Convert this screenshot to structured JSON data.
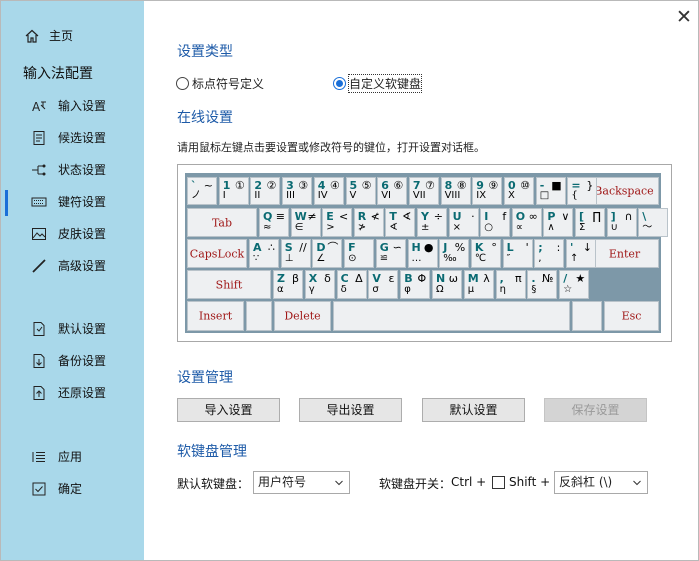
{
  "sidebar": {
    "home": "主页",
    "title": "输入法配置",
    "items": [
      {
        "label": "输入设置",
        "icon": "input-settings-icon"
      },
      {
        "label": "候选设置",
        "icon": "candidate-icon"
      },
      {
        "label": "状态设置",
        "icon": "status-icon"
      },
      {
        "label": "键符设置",
        "icon": "keyboard-icon"
      },
      {
        "label": "皮肤设置",
        "icon": "image-icon"
      },
      {
        "label": "高级设置",
        "icon": "wand-icon"
      },
      {
        "label": "默认设置",
        "icon": "default-doc-icon"
      },
      {
        "label": "备份设置",
        "icon": "backup-icon"
      },
      {
        "label": "还原设置",
        "icon": "restore-icon"
      },
      {
        "label": "应用",
        "icon": "list-icon"
      },
      {
        "label": "确定",
        "icon": "checkbox-icon"
      }
    ],
    "active_index": 3,
    "accent": "#1a6fd8",
    "bg": "#a9d8ea"
  },
  "window": {
    "close_glyph": "✕"
  },
  "type_section": {
    "title": "设置类型",
    "options": [
      "标点符号定义",
      "自定义软键盘"
    ],
    "selected": 1
  },
  "online_section": {
    "title": "在线设置",
    "hint": "请用鼠标左键点击要设置或修改符号的键位，打开设置对话框。"
  },
  "keyboard": {
    "row1": [
      {
        "t": "`",
        "tr": "~",
        "b": "ノ",
        "br": ""
      },
      {
        "t": "1",
        "tr": "①",
        "b": "I",
        "br": ""
      },
      {
        "t": "2",
        "tr": "②",
        "b": "II",
        "br": ""
      },
      {
        "t": "3",
        "tr": "③",
        "b": "III",
        "br": ""
      },
      {
        "t": "4",
        "tr": "④",
        "b": "IV",
        "br": ""
      },
      {
        "t": "5",
        "tr": "⑤",
        "b": "V",
        "br": ""
      },
      {
        "t": "6",
        "tr": "⑥",
        "b": "VI",
        "br": ""
      },
      {
        "t": "7",
        "tr": "⑦",
        "b": "VII",
        "br": ""
      },
      {
        "t": "8",
        "tr": "⑧",
        "b": "VIII",
        "br": ""
      },
      {
        "t": "9",
        "tr": "⑨",
        "b": "IX",
        "br": ""
      },
      {
        "t": "0",
        "tr": "⑩",
        "b": "X",
        "br": ""
      },
      {
        "t": "-",
        "tr": "■",
        "b": "□",
        "br": ""
      },
      {
        "t": "=",
        "tr": "}",
        "b": "{",
        "br": ""
      }
    ],
    "row2": [
      {
        "t": "Q",
        "tr": "≡",
        "b": "≈",
        "br": ""
      },
      {
        "t": "W",
        "tr": "≠",
        "b": "∈",
        "br": ""
      },
      {
        "t": "E",
        "tr": "<",
        "b": ">",
        "br": ""
      },
      {
        "t": "R",
        "tr": "≮",
        "b": "≯",
        "br": ""
      },
      {
        "t": "T",
        "tr": "∢",
        "b": "∢",
        "br": ""
      },
      {
        "t": "Y",
        "tr": "÷",
        "b": "±",
        "br": ""
      },
      {
        "t": "U",
        "tr": "·",
        "b": "×",
        "br": ""
      },
      {
        "t": "I",
        "tr": "f",
        "b": "○",
        "br": ""
      },
      {
        "t": "O",
        "tr": "∞",
        "b": "∝",
        "br": ""
      },
      {
        "t": "P",
        "tr": "∨",
        "b": "∧",
        "br": ""
      },
      {
        "t": "[",
        "tr": "∏",
        "b": "Σ",
        "br": ""
      },
      {
        "t": "]",
        "tr": "∩",
        "b": "∪",
        "br": ""
      },
      {
        "t": "\\",
        "tr": "",
        "b": "〜",
        "br": ""
      }
    ],
    "row3": [
      {
        "t": "A",
        "tr": "∴",
        "b": "∵",
        "br": ""
      },
      {
        "t": "S",
        "tr": "//",
        "b": "⊥",
        "br": ""
      },
      {
        "t": "D",
        "tr": "⌒",
        "b": "∠",
        "br": ""
      },
      {
        "t": "F",
        "tr": "",
        "b": "⊙",
        "br": ""
      },
      {
        "t": "G",
        "tr": "∽",
        "b": "≌",
        "br": ""
      },
      {
        "t": "H",
        "tr": "●",
        "b": "…",
        "br": ""
      },
      {
        "t": "J",
        "tr": "%",
        "b": "‰",
        "br": ""
      },
      {
        "t": "K",
        "tr": "°",
        "b": "℃",
        "br": ""
      },
      {
        "t": "L",
        "tr": "'",
        "b": "″",
        "br": ""
      },
      {
        "t": ";",
        "tr": ":",
        "b": "‚",
        "br": ""
      },
      {
        "t": "'",
        "tr": "↓",
        "b": "↑",
        "br": ""
      }
    ],
    "row4": [
      {
        "t": "Z",
        "tr": "β",
        "b": "α",
        "br": ""
      },
      {
        "t": "X",
        "tr": "δ",
        "b": "γ",
        "br": ""
      },
      {
        "t": "C",
        "tr": "Δ",
        "b": "δ",
        "br": ""
      },
      {
        "t": "V",
        "tr": "ε",
        "b": "σ",
        "br": ""
      },
      {
        "t": "B",
        "tr": "Φ",
        "b": "φ",
        "br": ""
      },
      {
        "t": "N",
        "tr": "ω",
        "b": "Ω",
        "br": ""
      },
      {
        "t": "M",
        "tr": "λ",
        "b": "μ",
        "br": ""
      },
      {
        "t": ",",
        "tr": "π",
        "b": "η",
        "br": ""
      },
      {
        "t": ".",
        "tr": "№",
        "b": "§",
        "br": ""
      },
      {
        "t": "/",
        "tr": "★",
        "b": "☆",
        "br": ""
      }
    ],
    "fn": {
      "backspace": "Backspace",
      "tab": "Tab",
      "capslock": "CapsLock",
      "enter": "Enter",
      "shift": "Shift",
      "insert": "Insert",
      "delete": "Delete",
      "esc": "Esc"
    }
  },
  "manage_section": {
    "title": "设置管理",
    "buttons": [
      "导入设置",
      "导出设置",
      "默认设置",
      "保存设置"
    ]
  },
  "softkb_section": {
    "title": "软键盘管理",
    "default_label": "默认软键盘：",
    "default_value": "用户符号",
    "switch_label": "软键盘开关：",
    "ctrl": "Ctrl +",
    "shift": "Shift +",
    "switch_key_value": "反斜杠 (\\)"
  }
}
